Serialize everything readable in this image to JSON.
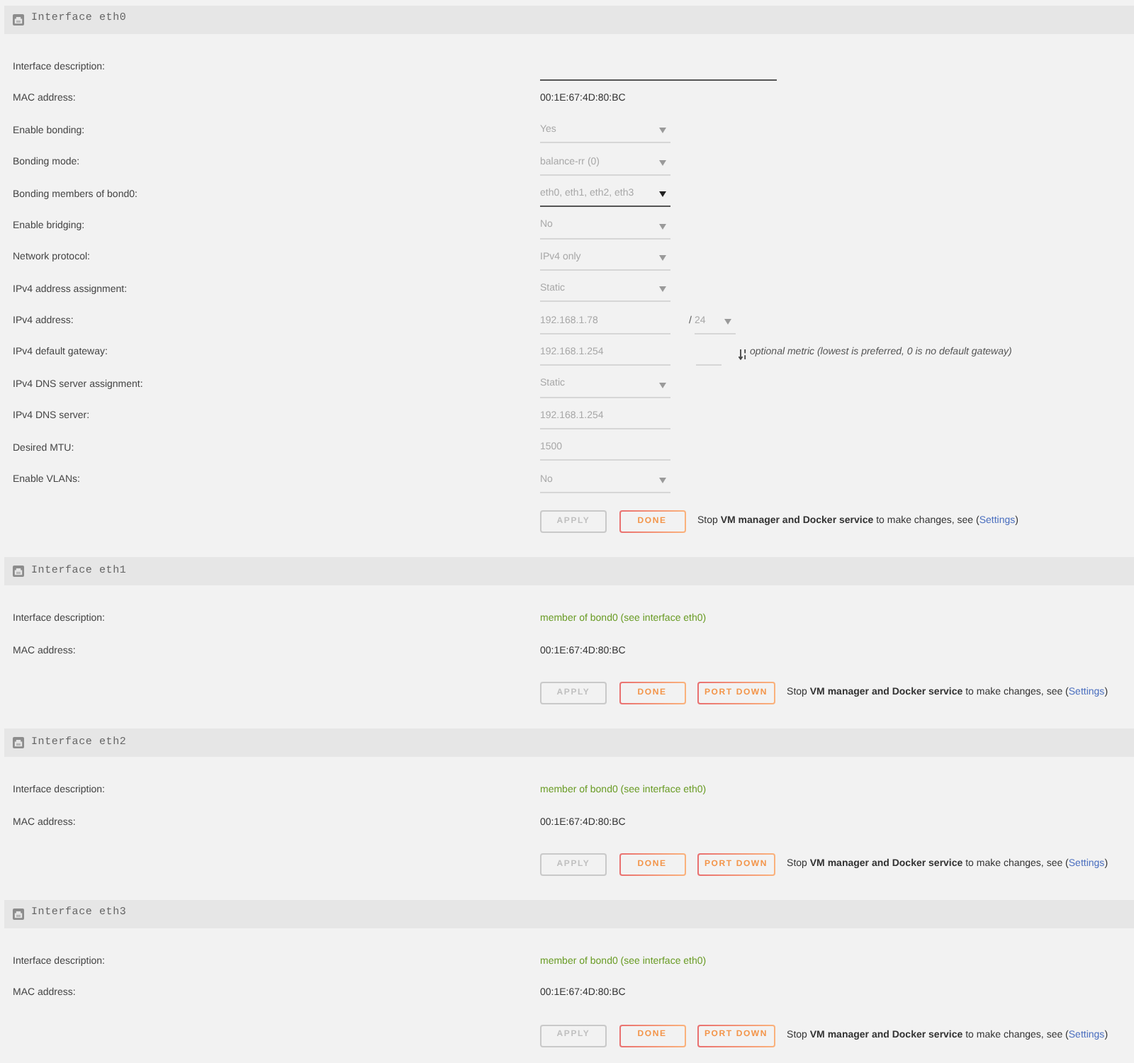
{
  "interfaces": [
    {
      "title": "Interface eth0",
      "rows": [
        {
          "label": "Interface description:",
          "field": {
            "kind": "input",
            "disabled": false
          }
        },
        {
          "label": "MAC address:",
          "field": {
            "kind": "text",
            "value": "00:1E:67:4D:80:BC"
          }
        },
        {
          "label": "Enable bonding:",
          "field": {
            "kind": "select",
            "value": "Yes",
            "disabled": true
          }
        },
        {
          "label": "Bonding mode:",
          "field": {
            "kind": "select",
            "value": "balance-rr (0)",
            "disabled": true
          }
        },
        {
          "label": "Bonding members of bond0:",
          "field": {
            "kind": "select",
            "value": "eth0, eth1, eth2, eth3",
            "disabled": false
          }
        },
        {
          "label": "Enable bridging:",
          "field": {
            "kind": "select",
            "value": "No",
            "disabled": true
          }
        },
        {
          "label": "Network protocol:",
          "field": {
            "kind": "select",
            "value": "IPv4 only",
            "disabled": true
          }
        },
        {
          "label": "IPv4 address assignment:",
          "field": {
            "kind": "select",
            "value": "Static",
            "disabled": true
          }
        },
        {
          "label": "IPv4 address:",
          "field": {
            "kind": "input",
            "value": "192.168.1.78",
            "disabled": true
          },
          "after": [
            {
              "kind": "separator",
              "text": "/"
            },
            {
              "kind": "select",
              "value": "24",
              "disabled": true
            }
          ]
        },
        {
          "label": "IPv4 default gateway:",
          "field": {
            "kind": "input",
            "value": "192.168.1.254",
            "disabled": true
          },
          "after": [
            {
              "kind": "input",
              "disabled": true
            },
            {
              "kind": "hint",
              "text": "optional metric (lowest is preferred, 0 is no default gateway)"
            }
          ]
        },
        {
          "label": "IPv4 DNS server assignment:",
          "field": {
            "kind": "select",
            "value": "Static",
            "disabled": true
          }
        },
        {
          "label": "IPv4 DNS server:",
          "field": {
            "kind": "input",
            "value": "192.168.1.254",
            "disabled": true
          }
        },
        {
          "label": "Desired MTU:",
          "field": {
            "kind": "input",
            "value": "1500",
            "disabled": true
          }
        },
        {
          "label": "Enable VLANs:",
          "field": {
            "kind": "select",
            "value": "No",
            "disabled": true
          }
        }
      ],
      "buttons": [
        {
          "label": "APPLY",
          "disabled": true
        },
        {
          "label": "DONE",
          "disabled": false
        }
      ],
      "note": {
        "before": "Stop **VM manager and Docker service** to make changes, see (",
        "link": "Settings",
        "after": ")"
      }
    },
    {
      "title": "Interface eth1",
      "rows": [
        {
          "label": "Interface description:",
          "field": {
            "kind": "status",
            "value": "member of bond0 (see interface eth0)"
          }
        },
        {
          "label": "MAC address:",
          "field": {
            "kind": "text",
            "value": "00:1E:67:4D:80:BC"
          }
        }
      ],
      "buttons": [
        {
          "label": "APPLY",
          "disabled": true
        },
        {
          "label": "DONE",
          "disabled": false
        },
        {
          "label": "PORT DOWN",
          "disabled": false
        }
      ],
      "note": {
        "before": "Stop **VM manager and Docker service** to make changes, see (",
        "link": "Settings",
        "after": ")"
      }
    },
    {
      "title": "Interface eth2",
      "rows": [
        {
          "label": "Interface description:",
          "field": {
            "kind": "status",
            "value": "member of bond0 (see interface eth0)"
          }
        },
        {
          "label": "MAC address:",
          "field": {
            "kind": "text",
            "value": "00:1E:67:4D:80:BC"
          }
        }
      ],
      "buttons": [
        {
          "label": "APPLY",
          "disabled": true
        },
        {
          "label": "DONE",
          "disabled": false
        },
        {
          "label": "PORT DOWN",
          "disabled": false
        }
      ],
      "note": {
        "before": "Stop **VM manager and Docker service** to make changes, see (",
        "link": "Settings",
        "after": ")"
      }
    },
    {
      "title": "Interface eth3",
      "rows": [
        {
          "label": "Interface description:",
          "field": {
            "kind": "status",
            "value": "member of bond0 (see interface eth0)"
          }
        },
        {
          "label": "MAC address:",
          "field": {
            "kind": "text",
            "value": "00:1E:67:4D:80:BC"
          }
        }
      ],
      "buttons": [
        {
          "label": "APPLY",
          "disabled": true
        },
        {
          "label": "DONE",
          "disabled": false
        },
        {
          "label": "PORT DOWN",
          "disabled": false
        }
      ],
      "note": {
        "before": "Stop **VM manager and Docker service** to make changes, see (",
        "link": "Settings",
        "after": ")"
      }
    }
  ]
}
